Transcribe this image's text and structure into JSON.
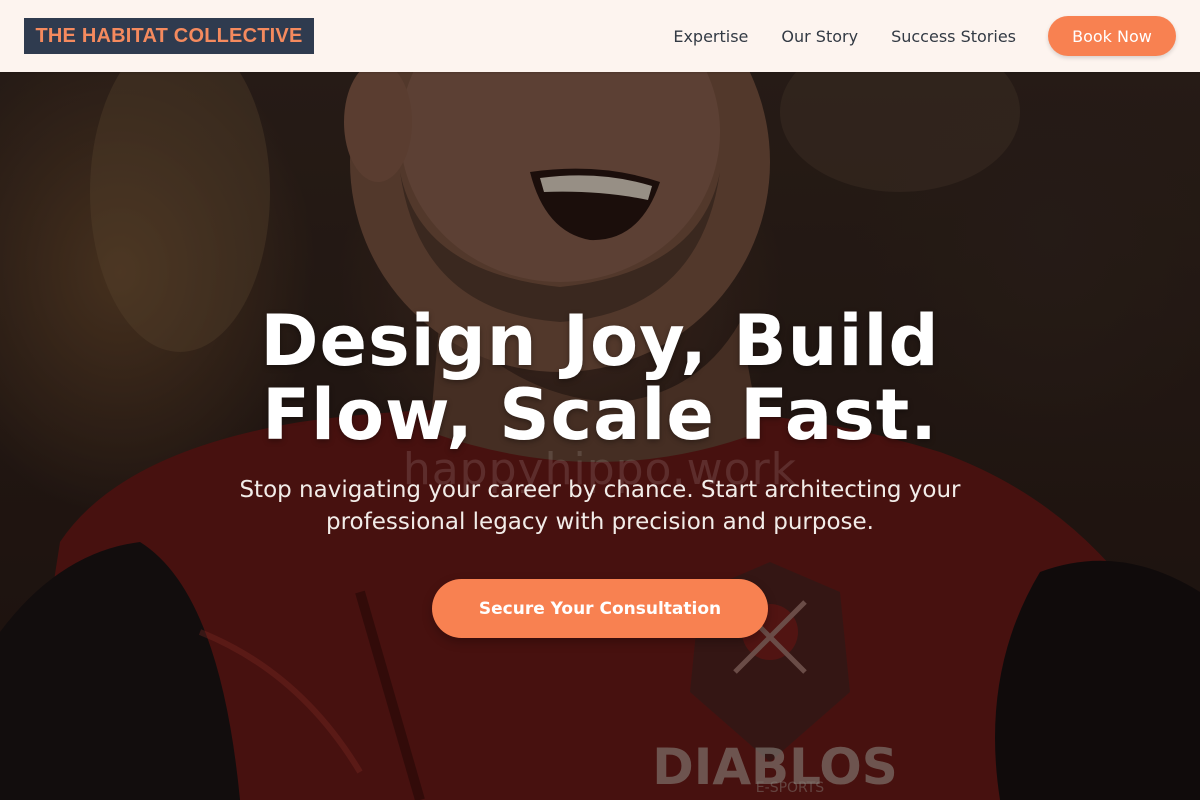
{
  "header": {
    "logo": "THE HABITAT COLLECTIVE",
    "nav": [
      "Expertise",
      "Our Story",
      "Success Stories"
    ],
    "cta_label": "Book Now"
  },
  "hero": {
    "title_line1": "Design Joy, Build",
    "title_line2": "Flow, Scale Fast.",
    "watermark": "happyhippo.work",
    "subtitle": "Stop navigating your career by chance. Start architecting your professional legacy with precision and purpose.",
    "cta_label": "Secure Your Consultation",
    "jersey_text": "DIABLOS",
    "jersey_subtext": "E-SPORTS"
  },
  "colors": {
    "accent": "#f88151",
    "logo_bg": "#2f3b4f",
    "header_bg": "#fdf4ef"
  }
}
